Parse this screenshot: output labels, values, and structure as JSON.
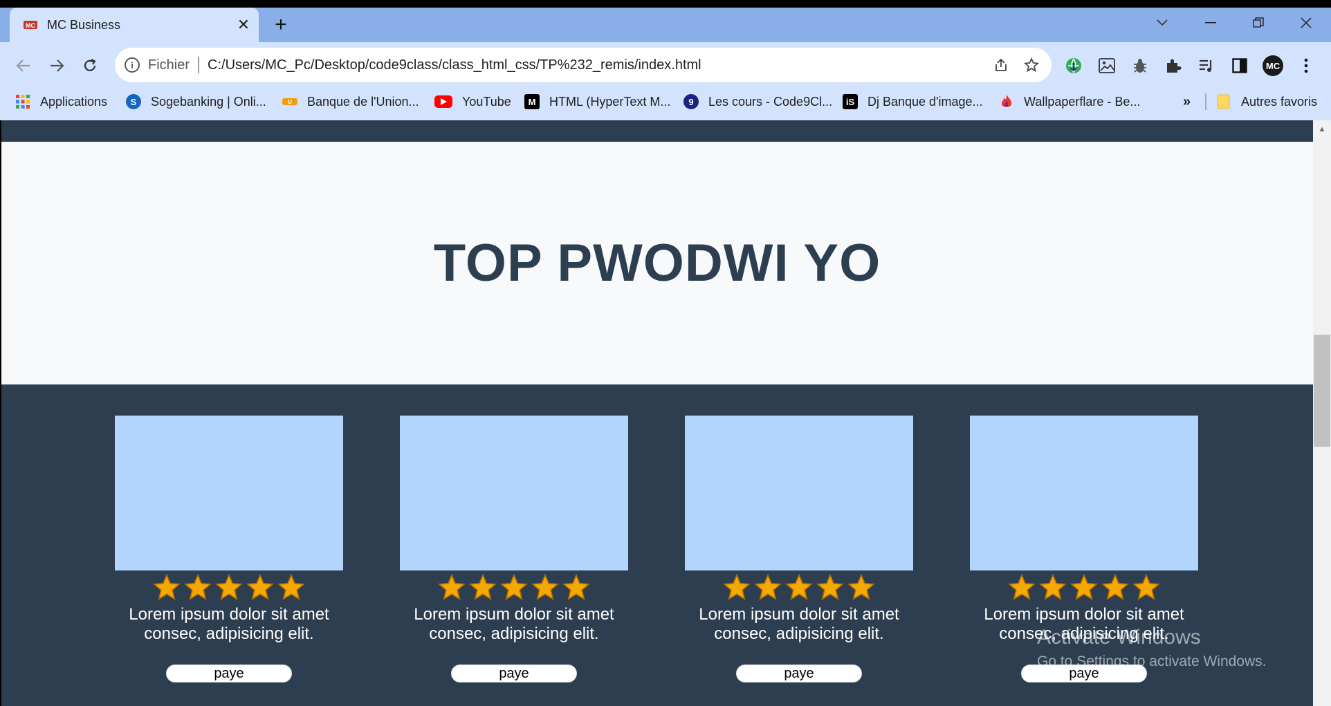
{
  "browser": {
    "tab": {
      "title": "MC Business",
      "favicon": "mc-logo-icon"
    },
    "omnibox": {
      "scheme_label": "Fichier",
      "url": "C:/Users/MC_Pc/Desktop/code9class/class_html_css/TP%232_remis/index.html"
    },
    "bookmarks": [
      {
        "label": "Applications",
        "icon": "apps-grid-icon"
      },
      {
        "label": "Sogebanking | Onli...",
        "icon": "sogebank-icon"
      },
      {
        "label": "Banque de l'Union...",
        "icon": "unibank-icon"
      },
      {
        "label": "YouTube",
        "icon": "youtube-icon"
      },
      {
        "label": "HTML (HyperText M...",
        "icon": "mdn-icon"
      },
      {
        "label": "Les cours - Code9Cl...",
        "icon": "code9-icon"
      },
      {
        "label": "Dj Banque d'image...",
        "icon": "istock-icon"
      },
      {
        "label": "Wallpaperflare - Be...",
        "icon": "flame-icon"
      }
    ],
    "bookmarks_overflow": "»",
    "other_bookmarks": "Autres favoris",
    "profile_initials": "MC"
  },
  "page": {
    "heading": "TOP PWODWI YO",
    "products": [
      {
        "text": "Lorem ipsum dolor sit amet consec, adipisicing elit.",
        "rating": 5,
        "button": "paye"
      },
      {
        "text": "Lorem ipsum dolor sit amet consec, adipisicing elit.",
        "rating": 5,
        "button": "paye"
      },
      {
        "text": "Lorem ipsum dolor sit amet consec, adipisicing elit.",
        "rating": 5,
        "button": "paye"
      },
      {
        "text": "Lorem ipsum dolor sit amet consec, adipisicing elit.",
        "rating": 5,
        "button": "paye"
      }
    ]
  },
  "watermark": {
    "title": "Activate Windows",
    "subtitle": "Go to Settings to activate Windows."
  },
  "colors": {
    "dark_section": "#2c3e50",
    "hero_bg": "#f7f9fb",
    "card_image": "#b3d4fc",
    "tabstrip": "#8aaee8",
    "toolbar": "#d3e3fd",
    "star": "#f5a800"
  }
}
